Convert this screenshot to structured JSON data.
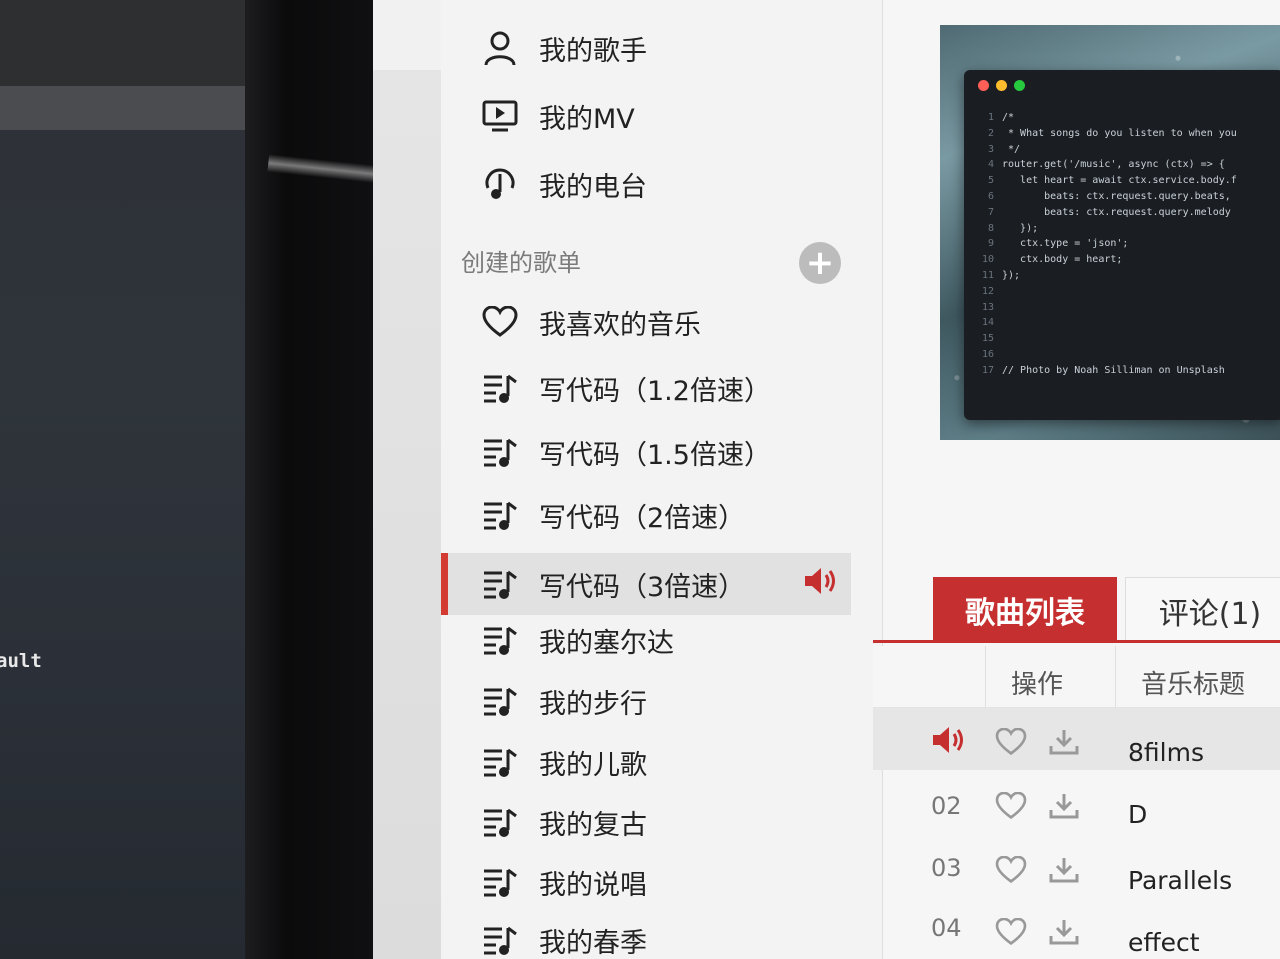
{
  "terminal": {
    "text": "ault"
  },
  "sidebar": {
    "top_items": [
      {
        "label": "我的歌手",
        "icon": "person-icon"
      },
      {
        "label": "我的MV",
        "icon": "video-icon"
      },
      {
        "label": "我的电台",
        "icon": "radio-icon"
      }
    ],
    "section_title": "创建的歌单",
    "add_label": "+",
    "playlists": [
      {
        "label": "我喜欢的音乐",
        "icon": "heart-icon"
      },
      {
        "label": "写代码（1.2倍速）",
        "icon": "playlist-icon"
      },
      {
        "label": "写代码（1.5倍速）",
        "icon": "playlist-icon"
      },
      {
        "label": "写代码（2倍速）",
        "icon": "playlist-icon"
      },
      {
        "label": "写代码（3倍速）",
        "icon": "playlist-icon",
        "active": true
      },
      {
        "label": "我的塞尔达",
        "icon": "playlist-icon"
      },
      {
        "label": "我的步行",
        "icon": "playlist-icon"
      },
      {
        "label": "我的儿歌",
        "icon": "playlist-icon"
      },
      {
        "label": "我的复古",
        "icon": "playlist-icon"
      },
      {
        "label": "我的说唱",
        "icon": "playlist-icon"
      },
      {
        "label": "我的春季",
        "icon": "playlist-icon"
      }
    ]
  },
  "cover": {
    "code_lines": [
      {
        "n": "1",
        "t": "/*"
      },
      {
        "n": "2",
        "t": " * What songs do you listen to when you"
      },
      {
        "n": "3",
        "t": " */"
      },
      {
        "n": "4",
        "t": "router.get('/music', async (ctx) => {"
      },
      {
        "n": "5",
        "t": "   let heart = await ctx.service.body.f"
      },
      {
        "n": "6",
        "t": "       beats: ctx.request.query.beats,"
      },
      {
        "n": "7",
        "t": "       beats: ctx.request.query.melody"
      },
      {
        "n": "8",
        "t": "   });"
      },
      {
        "n": "9",
        "t": "   ctx.type = 'json';"
      },
      {
        "n": "10",
        "t": "   ctx.body = heart;"
      },
      {
        "n": "11",
        "t": "});"
      },
      {
        "n": "12",
        "t": ""
      },
      {
        "n": "13",
        "t": ""
      },
      {
        "n": "14",
        "t": ""
      },
      {
        "n": "15",
        "t": ""
      },
      {
        "n": "16",
        "t": ""
      },
      {
        "n": "17",
        "t": "// Photo by Noah Silliman on Unsplash"
      }
    ]
  },
  "tabs": {
    "songs": "歌曲列表",
    "comments": "评论(1)"
  },
  "table": {
    "headers": {
      "action": "操作",
      "title": "音乐标题"
    },
    "rows": [
      {
        "num": "",
        "title": "8films",
        "playing": true
      },
      {
        "num": "02",
        "title": "D"
      },
      {
        "num": "03",
        "title": "Parallels"
      },
      {
        "num": "04",
        "title": "effect"
      }
    ]
  },
  "colors": {
    "accent": "#c62f2f",
    "active_bar": "#d33a31"
  }
}
